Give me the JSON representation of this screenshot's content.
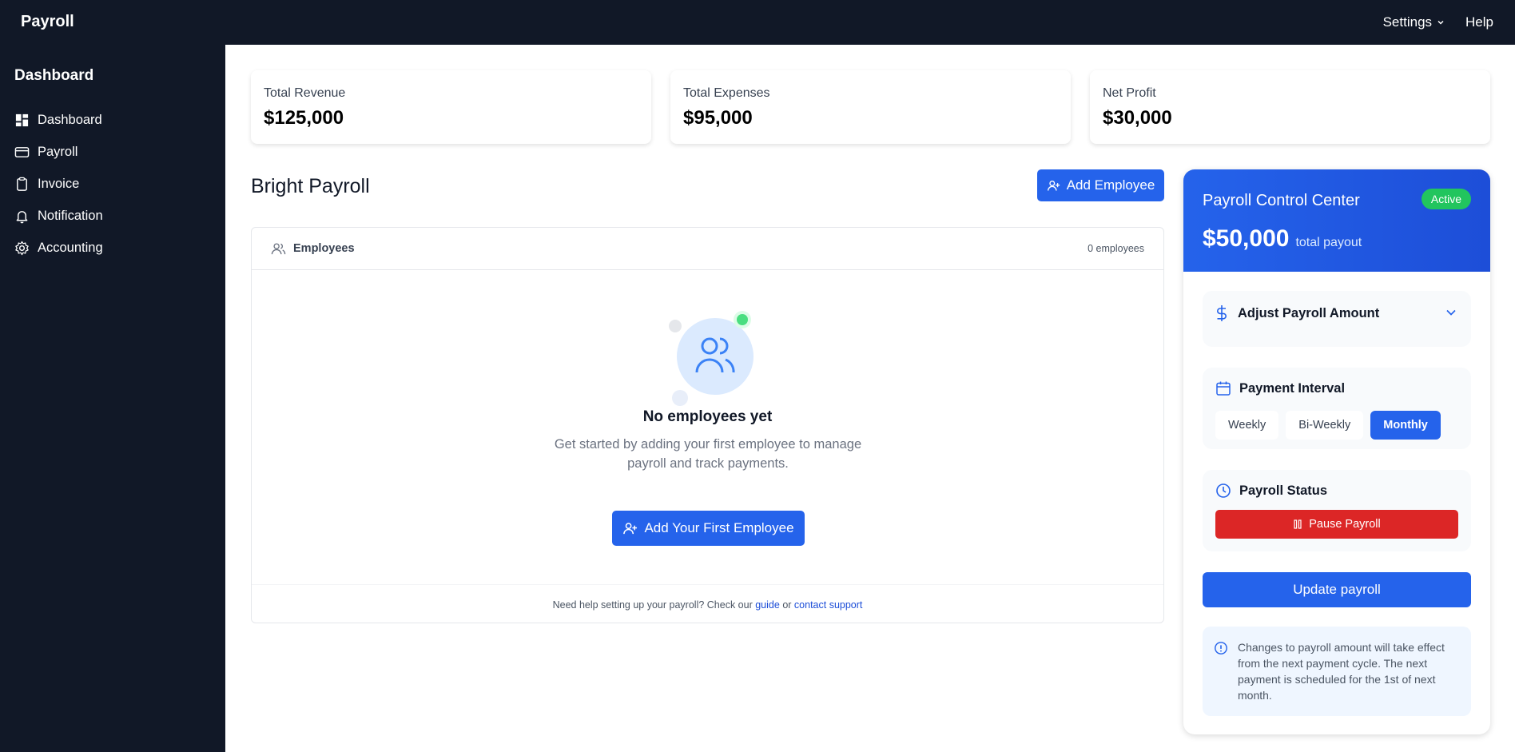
{
  "app": {
    "brand": "Payroll"
  },
  "topnav": {
    "settings": "Settings",
    "help": "Help"
  },
  "sidebar": {
    "heading": "Dashboard",
    "items": [
      {
        "label": "Dashboard",
        "icon": "dashboard-icon"
      },
      {
        "label": "Payroll",
        "icon": "card-icon"
      },
      {
        "label": "Invoice",
        "icon": "clipboard-icon"
      },
      {
        "label": "Notification",
        "icon": "bell-icon"
      },
      {
        "label": "Accounting",
        "icon": "gear-icon"
      }
    ]
  },
  "stats": [
    {
      "label": "Total Revenue",
      "value": "$125,000"
    },
    {
      "label": "Total Expenses",
      "value": "$95,000"
    },
    {
      "label": "Net Profit",
      "value": "$30,000"
    }
  ],
  "main": {
    "title": "Bright Payroll",
    "add_button": "Add Employee",
    "employees": {
      "header": "Employees",
      "count": "0 employees",
      "empty_title": "No employees yet",
      "empty_text": "Get started by adding your first employee to manage payroll and track payments.",
      "cta": "Add Your First Employee",
      "help_prefix": "Need help setting up your payroll? Check our",
      "guide_link": "guide",
      "or": "or",
      "support_link": "contact support"
    }
  },
  "panel": {
    "title": "Payroll Control Center",
    "status_badge": "Active",
    "payout_amount": "$50,000",
    "payout_label": "total payout",
    "adjust_label": "Adjust Payroll Amount",
    "interval_label": "Payment Interval",
    "intervals": [
      "Weekly",
      "Bi-Weekly",
      "Monthly"
    ],
    "selected_interval": "Monthly",
    "status_label": "Payroll Status",
    "pause_button": "Pause Payroll",
    "update_button": "Update payroll",
    "note": "Changes to payroll amount will take effect from the next payment cycle. The next payment is scheduled for the 1st of next month."
  },
  "colors": {
    "sidebar": "#111827",
    "primary": "#2563eb",
    "success": "#22c55e",
    "danger": "#dc2626"
  }
}
